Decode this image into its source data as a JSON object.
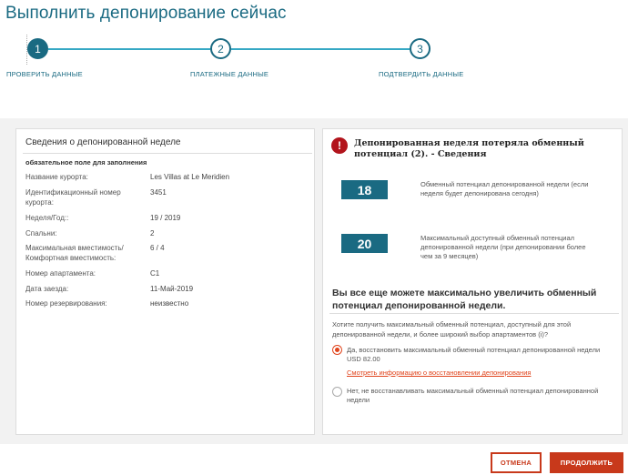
{
  "page": {
    "title": "Выполнить депонирование сейчас"
  },
  "stepper": {
    "steps": [
      {
        "number": "1",
        "label": "ПРОВЕРИТЬ ДАННЫЕ",
        "active": true
      },
      {
        "number": "2",
        "label": "ПЛАТЕЖНЫЕ ДАННЫЕ",
        "active": false
      },
      {
        "number": "3",
        "label": "ПОДТВЕРДИТЬ ДАННЫЕ",
        "active": false
      }
    ]
  },
  "details": {
    "header": "Сведения о депонированной неделе",
    "required_note": "обязательное поле для заполнения",
    "rows": [
      {
        "label": "Название курорта:",
        "value": "Les Villas at Le Meridien"
      },
      {
        "label": "Идентификационный номер курорта:",
        "value": "3451"
      },
      {
        "label": "Неделя/Год::",
        "value": "19 / 2019"
      },
      {
        "label": "Спальни:",
        "value": "2"
      },
      {
        "label": "Максимальная вместимость/ Комфортная вместимость:",
        "value": "6 / 4"
      },
      {
        "label": "Номер апартамента:",
        "value": "C1"
      },
      {
        "label": "Дата заезда:",
        "value": "11-Май-2019"
      },
      {
        "label": "Номер резервирования:",
        "value": "неизвестно"
      }
    ]
  },
  "power": {
    "warning_icon": "exclamation-icon",
    "warning_title": "Депонированная неделя потеряла обменный потенциал (2). - Сведения",
    "current_value": "18",
    "current_desc": "Обменный потенциал депонированной недели (если неделя будет депонирована сегодня)",
    "max_value": "20",
    "max_desc": "Максимальный доступный обменный потенциал депонированной недели (при депонировании более чем за 9 месяцев)",
    "upsell_title": "Вы все еще можете максимально увеличить обменный потенциал депонированной недели.",
    "upsell_text": "Хотите получить максимальный обменный потенциал, доступный для этой депонированной недели, и более широкий выбор апартаментов (i)?",
    "option_yes": "Да, восстановить максимальный обменный потенциал депонированной недели USD 82.00",
    "option_yes_link": "Смотреть информацию о восстановлении депонирования",
    "option_no": "Нет, не восстанавливать максимальный обменный потенциал депонированной недели",
    "selected": "yes"
  },
  "actions": {
    "cancel": "ОТМЕНА",
    "continue": "ПРОДОЛЖИТЬ"
  },
  "colors": {
    "primary": "#1a6a82",
    "accent": "#c8391b",
    "warning": "#b2141c"
  }
}
